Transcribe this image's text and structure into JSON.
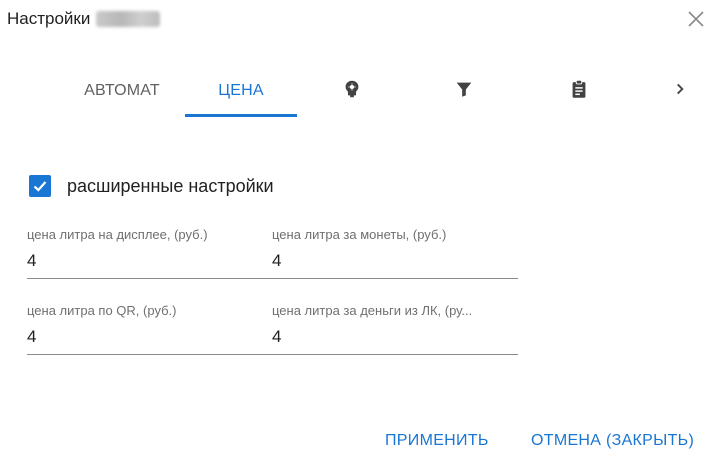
{
  "dialog": {
    "title": "Настройки"
  },
  "tabs": [
    {
      "label": "АВТОМАТ",
      "active": false
    },
    {
      "label": "ЦЕНА",
      "active": true
    },
    {
      "icon": "settings-bulb-icon"
    },
    {
      "icon": "filter-icon"
    },
    {
      "icon": "clipboard-icon"
    },
    {
      "icon": "chevron-right-icon"
    }
  ],
  "advanced": {
    "label": "расширенные настройки",
    "checked": true
  },
  "fields": [
    {
      "label": "цена литра на дисплее, (руб.)",
      "value": "4"
    },
    {
      "label": "цена литра за монеты, (руб.)",
      "value": "4"
    },
    {
      "label": "цена литра по QR, (руб.)",
      "value": "4"
    },
    {
      "label": "цена литра за деньги из ЛК, (ру...",
      "value": "4"
    }
  ],
  "buttons": {
    "apply": "ПРИМЕНИТЬ",
    "cancel": "ОТМЕНА (ЗАКРЫТЬ)"
  },
  "colors": {
    "accent": "#1976d2"
  }
}
